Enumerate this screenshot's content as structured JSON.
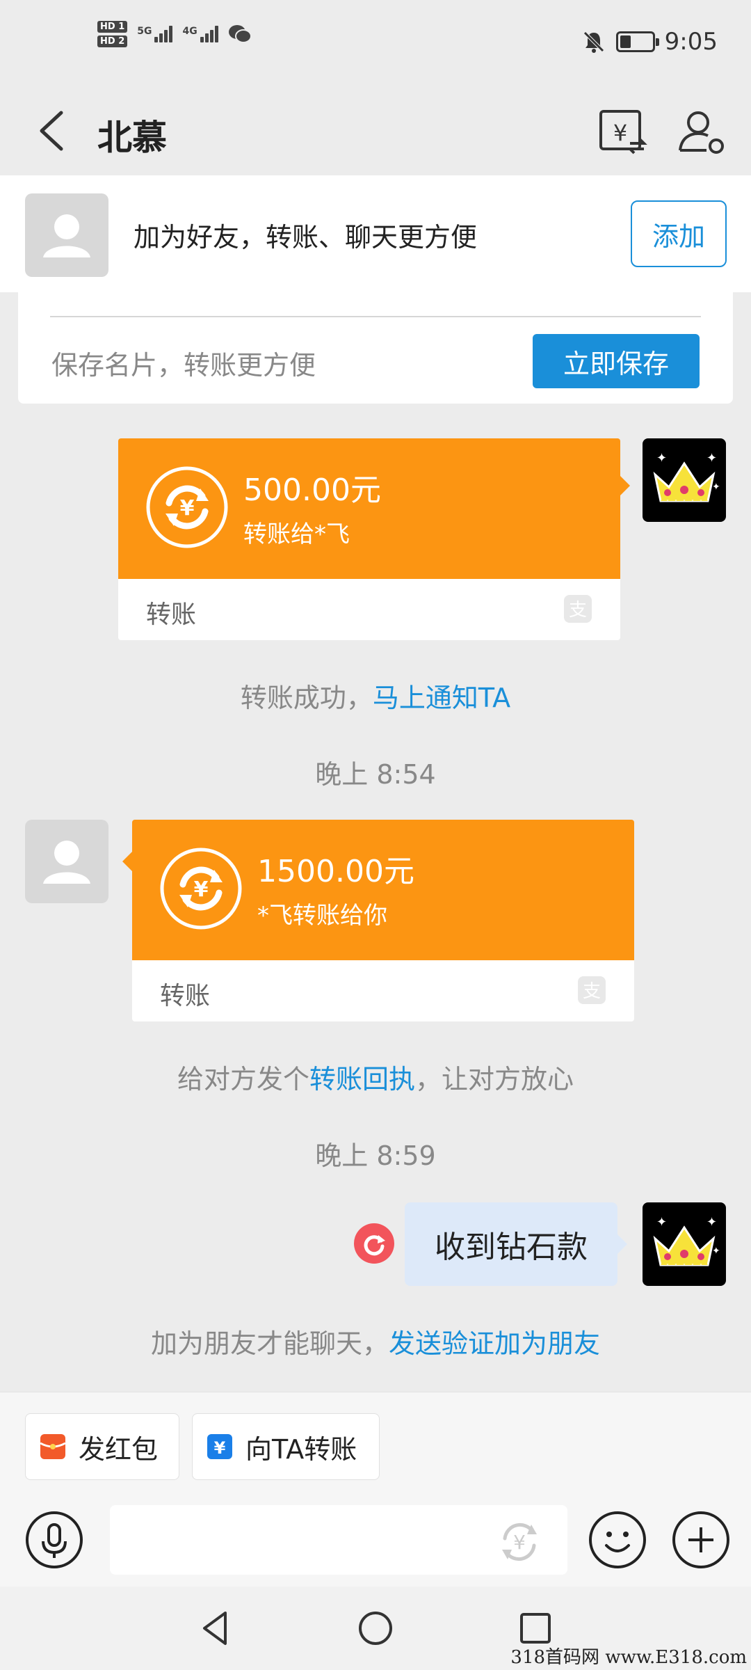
{
  "status_bar": {
    "sim1_label": "HD 1",
    "sim2_label": "HD 2",
    "network1": "5G",
    "network2": "4G",
    "time": "9:05",
    "battery_level": 0.35,
    "icons": [
      "wechat-icon",
      "mute-icon",
      "battery-icon"
    ]
  },
  "nav": {
    "title": "北慕",
    "icons": [
      "back-icon",
      "transfer-record-icon",
      "profile-settings-icon"
    ]
  },
  "add_friend_banner": {
    "text": "加为好友，转账、聊天更方便",
    "button_label": "添加"
  },
  "save_card": {
    "text": "保存名片，转账更方便",
    "button_label": "立即保存"
  },
  "messages": {
    "outgoing_transfer": {
      "amount": "500.00元",
      "description": "转账给*飞",
      "footer_label": "转账"
    },
    "transfer_notice": {
      "prefix": "转账成功，",
      "link": "马上通知TA"
    },
    "time_1": "晚上 8:54",
    "incoming_transfer": {
      "amount": "1500.00元",
      "description": "*飞转账给你",
      "footer_label": "转账"
    },
    "receipt_notice": {
      "prefix": "给对方发个",
      "link": "转账回执",
      "suffix": "，让对方放心"
    },
    "time_2": "晚上 8:59",
    "text_message": "收到钻石款",
    "friend_notice": {
      "prefix": "加为朋友才能聊天，",
      "link": "发送验证加为朋友"
    }
  },
  "bottom_panel": {
    "red_packet_label": "发红包",
    "transfer_label": "向TA转账",
    "input_value": "",
    "input_placeholder": ""
  },
  "colors": {
    "transfer_orange": "#fc9512",
    "link_blue": "#1a8fd9",
    "background": "#ececec",
    "bubble_blue": "#dde9f9",
    "resend_red": "#f2545b"
  },
  "watermark": "318首码网  www.E318.com"
}
